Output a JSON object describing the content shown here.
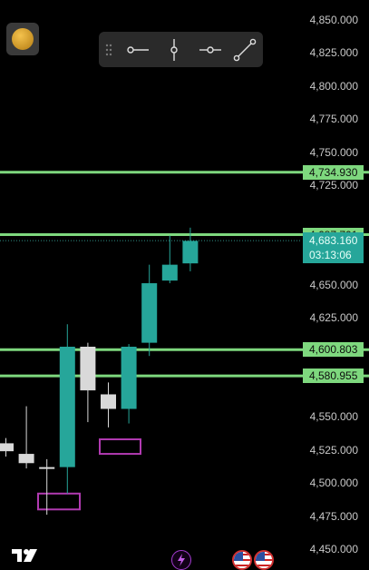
{
  "chart_data": {
    "type": "candlestick",
    "price_axis_ticks": [
      "4,850.000",
      "4,825.000",
      "4,800.000",
      "4,775.000",
      "4,750.000",
      "4,725.000",
      "4,650.000",
      "4,625.000",
      "4,550.000",
      "4,525.000",
      "4,500.000",
      "4,475.000",
      "4,450.000"
    ],
    "ylim": [
      4445,
      4855
    ],
    "horizontal_lines": [
      {
        "label": "4,734.930",
        "value": 4734.93
      },
      {
        "label": "4,687.701",
        "value": 4687.701
      },
      {
        "label": "4,600.803",
        "value": 4600.803
      },
      {
        "label": "4,580.955",
        "value": 4580.955
      }
    ],
    "current_price": {
      "label": "4,683.160",
      "value": 4683.16,
      "countdown": "03:13:06"
    },
    "candles": [
      {
        "open": 4530,
        "high": 4534,
        "low": 4520,
        "close": 4524,
        "color": "gray"
      },
      {
        "open": 4522,
        "high": 4558,
        "low": 4511,
        "close": 4515,
        "color": "gray"
      },
      {
        "open": 4512,
        "high": 4518,
        "low": 4476,
        "close": 4512,
        "color": "gray"
      },
      {
        "open": 4512,
        "high": 4620,
        "low": 4492,
        "close": 4603,
        "color": "green"
      },
      {
        "open": 4603,
        "high": 4606,
        "low": 4546,
        "close": 4570,
        "color": "gray"
      },
      {
        "open": 4567,
        "high": 4576,
        "low": 4542,
        "close": 4556,
        "color": "gray"
      },
      {
        "open": 4556,
        "high": 4605,
        "low": 4545,
        "close": 4603,
        "color": "green"
      },
      {
        "open": 4606,
        "high": 4665,
        "low": 4596,
        "close": 4651,
        "color": "green"
      },
      {
        "open": 4653,
        "high": 4687,
        "low": 4651,
        "close": 4665,
        "color": "green"
      },
      {
        "open": 4666,
        "high": 4693,
        "low": 4660,
        "close": 4683,
        "color": "green"
      }
    ],
    "boxes": [
      {
        "y_high": 4492,
        "y_low": 4480
      },
      {
        "y_high": 4533,
        "y_low": 4522
      }
    ],
    "colors": {
      "up": "#26a69a",
      "down": "#d9d9d9",
      "hline": "#7ed87e",
      "box": "#b13ab1"
    }
  },
  "toolbar": {
    "tools": [
      "horizontal-ray-tool",
      "vertical-line-tool",
      "horizontal-line-tool",
      "trend-line-tool"
    ]
  },
  "bottom_bar": {
    "icons": [
      "tradingview-logo",
      "lightning-icon",
      "us-flag-icon",
      "us-flag-icon"
    ]
  }
}
